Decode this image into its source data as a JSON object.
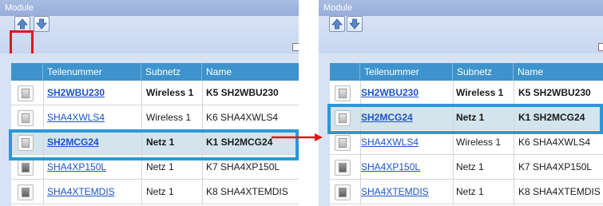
{
  "left": {
    "title": "Module",
    "checkbox_tail": "2",
    "columns": [
      "Teilenummer",
      "Subnetz",
      "Name"
    ],
    "rows": [
      {
        "part": "SH2WBU230",
        "subnet": "Wireless 1",
        "name": "K5 SH2WBU230",
        "bold": true,
        "icon": "light"
      },
      {
        "part": "SHA4XWLS4",
        "subnet": "Wireless 1",
        "name": "K6 SHA4XWLS4",
        "bold": false,
        "icon": "light"
      },
      {
        "part": "SH2MCG24",
        "subnet": "Netz 1",
        "name": "K1 SH2MCG24",
        "bold": true,
        "icon": "light",
        "selected": true
      },
      {
        "part": "SHA4XP150L",
        "subnet": "Netz 1",
        "name": "K7 SHA4XP150L",
        "bold": false,
        "icon": "dark"
      },
      {
        "part": "SHA4XTEMDIS",
        "subnet": "Netz 1",
        "name": "K8 SHA4XTEMDIS",
        "bold": false,
        "icon": "dark"
      }
    ]
  },
  "right": {
    "title": "Module",
    "columns": [
      "Teilenummer",
      "Subnetz",
      "Name"
    ],
    "rows": [
      {
        "part": "SH2WBU230",
        "subnet": "Wireless 1",
        "name": "K5 SH2WBU230",
        "bold": true,
        "icon": "light"
      },
      {
        "part": "SH2MCG24",
        "subnet": "Netz 1",
        "name": "K1 SH2MCG24",
        "bold": true,
        "icon": "light",
        "selected": true
      },
      {
        "part": "SHA4XWLS4",
        "subnet": "Wireless 1",
        "name": "K6 SHA4XWLS4",
        "bold": false,
        "icon": "light"
      },
      {
        "part": "SHA4XP150L",
        "subnet": "Netz 1",
        "name": "K7 SHA4XP150L",
        "bold": false,
        "icon": "dark"
      },
      {
        "part": "SHA4XTEMDIS",
        "subnet": "Netz 1",
        "name": "K8 SHA4XTEMDIS",
        "bold": false,
        "icon": "dark"
      }
    ]
  },
  "icons": {
    "move_up": "arrow-up-icon",
    "move_down": "arrow-down-icon",
    "device": "device-icon",
    "transition": "arrow-right-icon"
  },
  "colors": {
    "header": "#3e93cc",
    "selection_frame": "#2a98d8",
    "highlight": "#e0161b",
    "link": "#1d53c9"
  }
}
